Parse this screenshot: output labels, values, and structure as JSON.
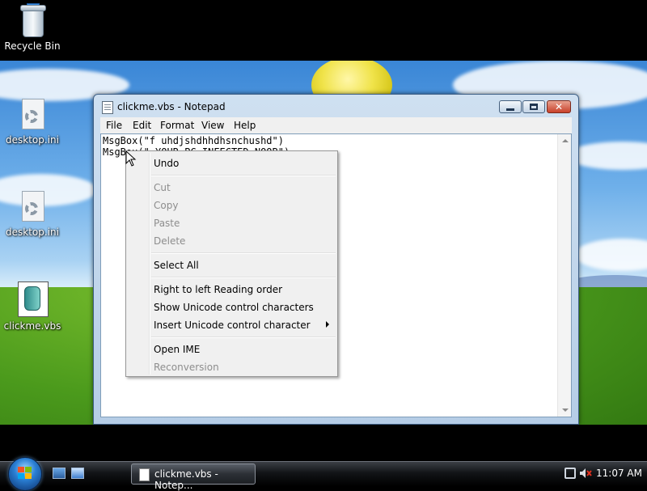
{
  "desktop": {
    "icons": [
      {
        "label": "Recycle Bin",
        "icon": "recycle-bin-icon"
      },
      {
        "label": "desktop.ini",
        "icon": "settings-file-icon"
      },
      {
        "label": "desktop.ini",
        "icon": "settings-file-icon"
      },
      {
        "label": "clickme.vbs",
        "icon": "script-file-icon"
      }
    ]
  },
  "window": {
    "title": "clickme.vbs - Notepad",
    "controls": {
      "minimize": "minimize-icon",
      "maximize": "maximize-icon",
      "close": "close-icon"
    },
    "menu": [
      "File",
      "Edit",
      "Format",
      "View",
      "Help"
    ],
    "editor_lines": [
      "MsgBox(\"f uhdjshdhhdhsnchushd\")",
      "MsgBox(\" YOUR PC INFECTED NOOB\")"
    ]
  },
  "context_menu": {
    "items": [
      {
        "label": "Undo",
        "enabled": true
      },
      {
        "label": "Cut",
        "enabled": false
      },
      {
        "label": "Copy",
        "enabled": false
      },
      {
        "label": "Paste",
        "enabled": false
      },
      {
        "label": "Delete",
        "enabled": false
      },
      {
        "label": "Select All",
        "enabled": true
      },
      {
        "label": "Right to left Reading order",
        "enabled": true
      },
      {
        "label": "Show Unicode control characters",
        "enabled": true
      },
      {
        "label": "Insert Unicode control character",
        "enabled": true,
        "submenu": true
      },
      {
        "label": "Open IME",
        "enabled": true
      },
      {
        "label": "Reconversion",
        "enabled": false
      }
    ]
  },
  "taskbar": {
    "start": "start-orb-icon",
    "task_button": "clickme.vbs - Notep...",
    "clock": "11:07 AM"
  },
  "colors": {
    "window_frame": "#b5cde6",
    "close_button": "#c8412a",
    "disabled_text": "#8d8d8d"
  }
}
